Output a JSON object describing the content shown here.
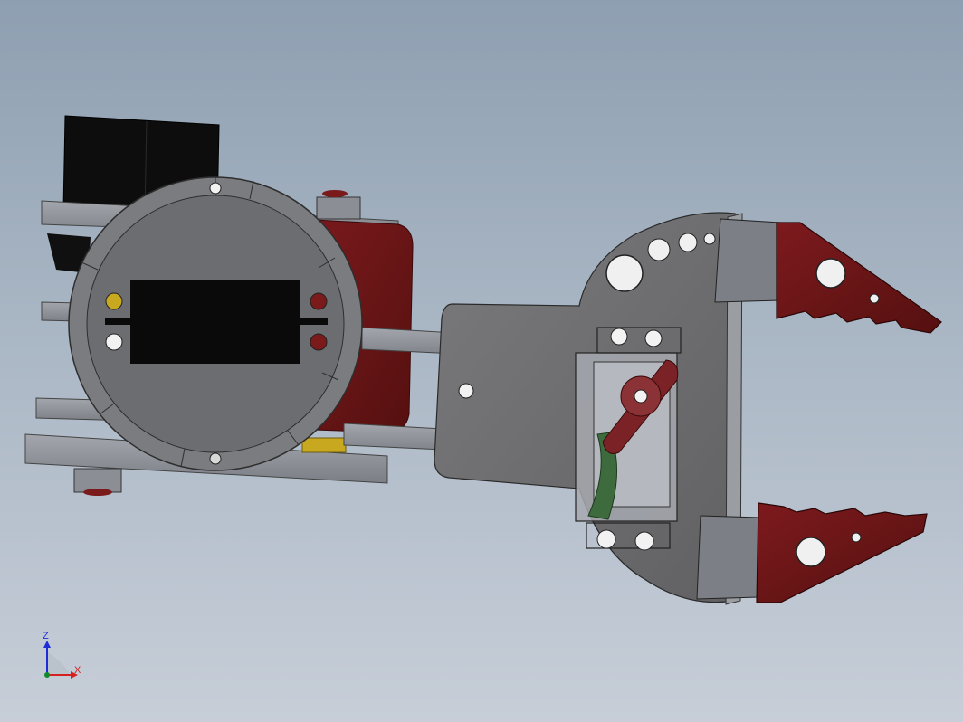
{
  "viewport": {
    "background_top": "#8e9fb1",
    "background_bottom": "#c7ced8"
  },
  "model": {
    "colors": {
      "plate_gray": "#6f6f70",
      "bracket_gray": "#8a8d92",
      "motor_black": "#0a0a0a",
      "jaw_red": "#6a1418",
      "servo_horn_red": "#7a2226",
      "linkage_green": "#3e6b3e",
      "accent_yellow": "#c8a81e"
    }
  },
  "triad": {
    "z_label": "Z",
    "x_label": "X",
    "z_color": "#1e2bd6",
    "x_color": "#d62020",
    "origin_color": "#0f8a2a"
  }
}
